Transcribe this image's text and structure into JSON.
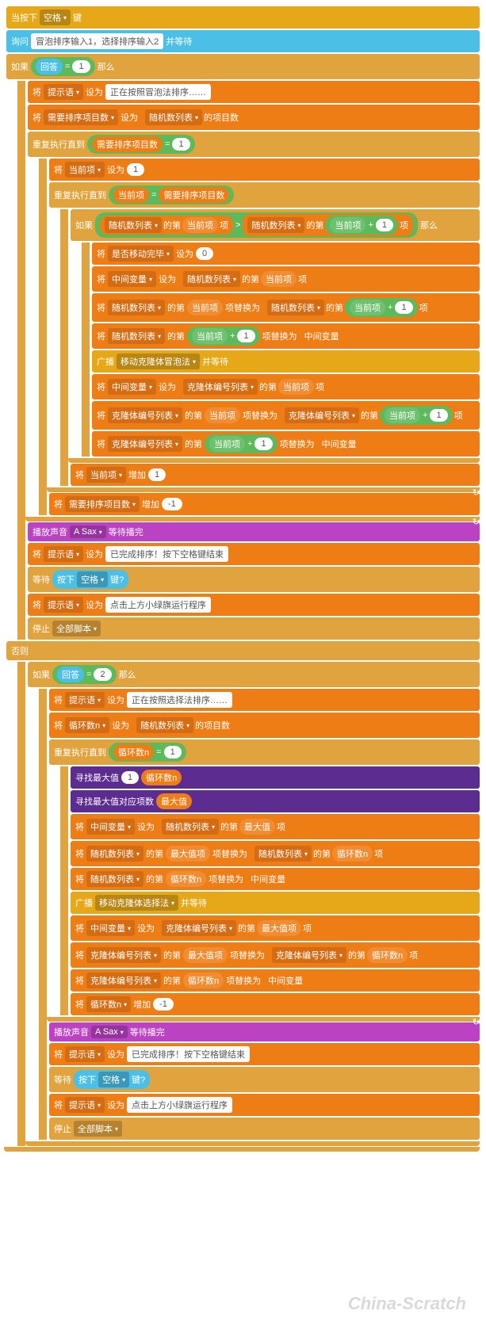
{
  "hat": {
    "when_pressed": "当按下",
    "key": "空格",
    "key_suffix": "键"
  },
  "ask": {
    "prefix": "询问",
    "text": "冒泡排序输入1，选择排序输入2",
    "suffix": "并等待"
  },
  "ctrl": {
    "if": "如果",
    "then": "那么",
    "else": "否则",
    "repeat_until": "重复执行直到",
    "wait_until": "等待",
    "stop": "停止",
    "stop_opt": "全部脚本"
  },
  "ops": {
    "eq": "=",
    "gt": ">",
    "plus": "+"
  },
  "sense": {
    "answer": "回答",
    "key_pressed_prefix": "按下",
    "key": "空格",
    "key_pressed_suffix": "键?"
  },
  "data": {
    "set": "将",
    "set_to": "设为",
    "set_word": "设为",
    "change": "增加",
    "set_action": "设为",
    "var_tip": "提示语",
    "var_items_to_sort": "需要排序项目数",
    "var_current": "当前项",
    "var_done_moving": "是否移动完毕",
    "var_temp": "中间变量",
    "var_loop_n": "循环数n",
    "var_max_val": "最大值",
    "var_max_item": "最大值项",
    "list_random": "随机数列表",
    "list_clone": "克隆体编号列表",
    "item_of": "的第",
    "item_suffix": "项",
    "items_count": "的项目数",
    "replace": "项替换为",
    "set_cn": "设为"
  },
  "vals": {
    "one": "1",
    "two": "2",
    "zero": "0",
    "neg1": "-1",
    "sorting_bubble": "正在按照冒泡法排序……",
    "sorting_select": "正在按照选择法排序……",
    "done": "已完成排序！按下空格键结束",
    "click_flag": "点击上方小绿旗运行程序"
  },
  "broadcast": {
    "label": "广播",
    "msg_bubble": "移动克隆体冒泡法",
    "msg_select": "移动克隆体选择法",
    "and_wait": "并等待"
  },
  "sound": {
    "play": "播放声音",
    "name": "A Sax",
    "wait": "等待播完"
  },
  "custom": {
    "find_max": "寻找最大值",
    "find_max_idx": "寻找最大值对应项数",
    "param_loop": "循环数n",
    "param_max": "最大值"
  },
  "watermark": "China-Scratch"
}
